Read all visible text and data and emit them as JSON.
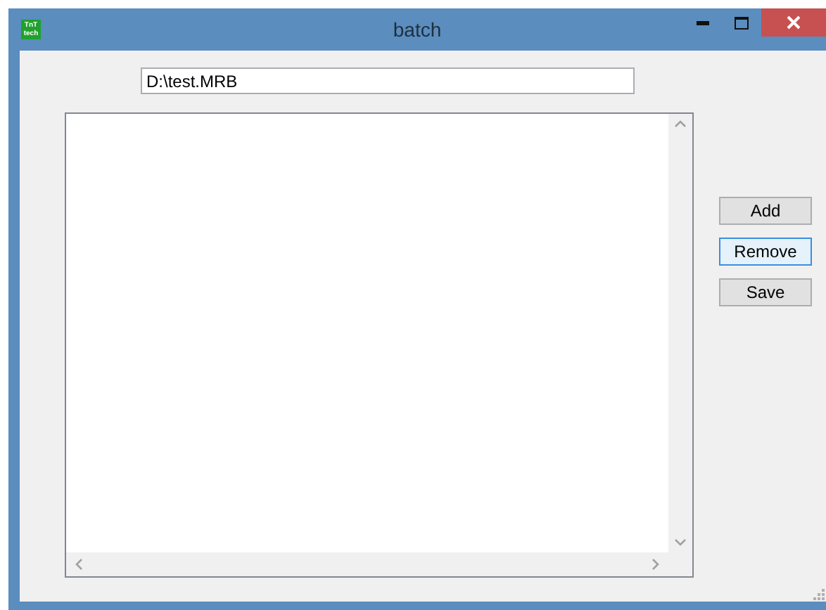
{
  "window": {
    "title": "batch",
    "logo": [
      "TnT",
      "tech"
    ]
  },
  "path_field": {
    "value": "D:\\test.MRB"
  },
  "buttons": [
    {
      "label": "Add",
      "focused": false
    },
    {
      "label": "Remove",
      "focused": true
    },
    {
      "label": "Save",
      "focused": false
    }
  ]
}
